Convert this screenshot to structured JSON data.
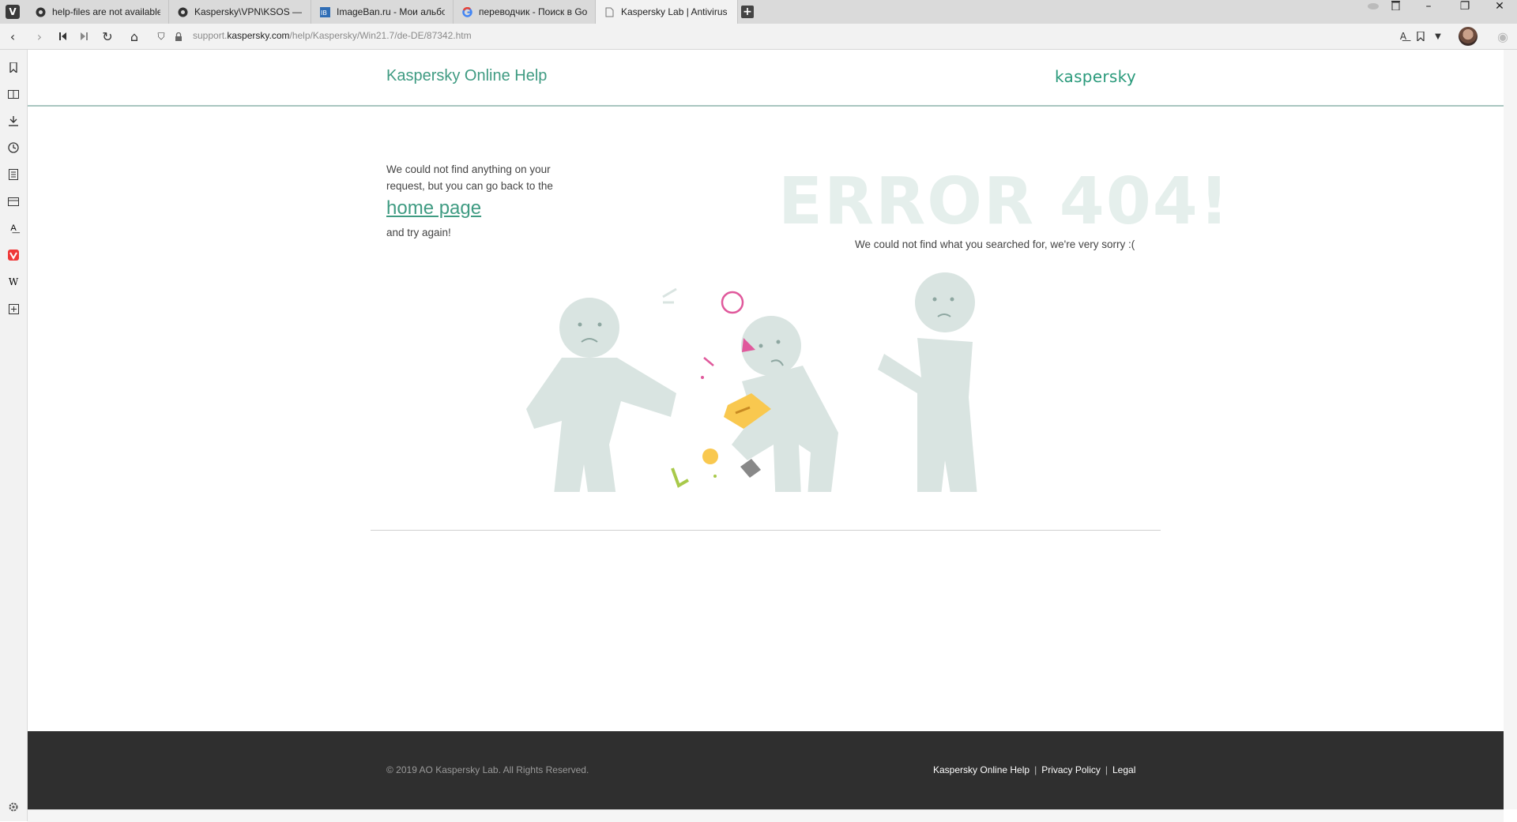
{
  "browser": {
    "tabs": [
      {
        "title": "help-files are not available",
        "icon": "globe-icon"
      },
      {
        "title": "Kaspersky\\VPN\\KSOS — 21",
        "icon": "globe-icon"
      },
      {
        "title": "ImageBan.ru - Мои альбом",
        "icon": "imageban-icon"
      },
      {
        "title": "переводчик - Поиск в Goo",
        "icon": "google-icon"
      },
      {
        "title": "Kaspersky Lab | Antivirus P",
        "icon": "page-icon"
      }
    ],
    "address": {
      "prefix": "support.",
      "domain": "kaspersky.com",
      "path": "/help/Kaspersky/Win21.7/de-DE/87342.htm"
    }
  },
  "page": {
    "header": {
      "title": "Kaspersky Online Help",
      "brand": "kaspersky"
    },
    "error": {
      "message_line": "We could not find anything on your request, but you can go back to the",
      "home_link": "home page",
      "retry": "and try again!",
      "code": "ERROR 404!",
      "sorry": "We could not find what you searched for, we're very sorry :("
    },
    "footer": {
      "copyright": "© 2019 AO Kaspersky Lab. All Rights Reserved.",
      "links": [
        "Kaspersky Online Help",
        "Privacy Policy",
        "Legal"
      ]
    }
  },
  "colors": {
    "accent": "#3f9b82",
    "figures": "#d9e4e1",
    "box": "#f9c84f",
    "footer": "#2f2f2f"
  }
}
